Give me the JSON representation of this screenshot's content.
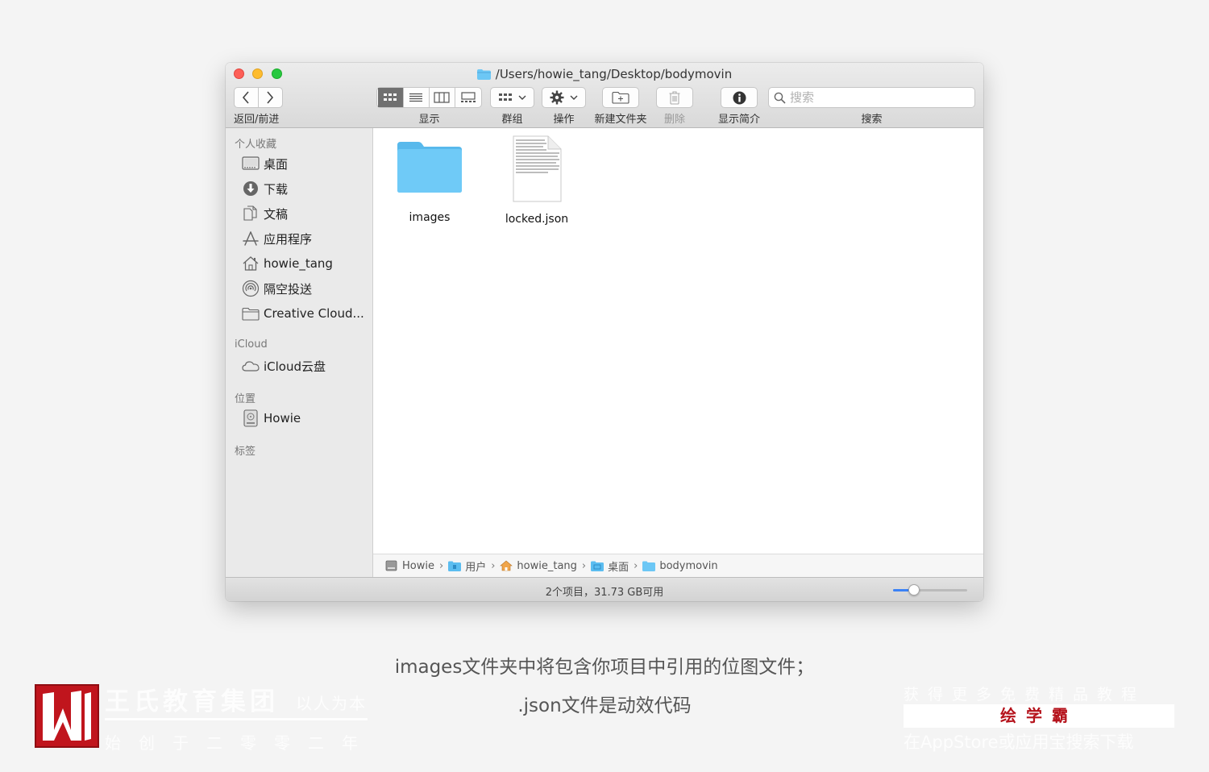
{
  "window": {
    "title": "/Users/howie_tang/Desktop/bodymovin"
  },
  "toolbar": {
    "nav_label": "返回/前进",
    "view_label": "显示",
    "group_label": "群组",
    "action_label": "操作",
    "new_folder_label": "新建文件夹",
    "delete_label": "删除",
    "info_label": "显示简介",
    "search_label": "搜索",
    "search_placeholder": "搜索"
  },
  "sidebar": {
    "favorites_header": "个人收藏",
    "favorites": [
      {
        "label": "桌面",
        "icon": "desktop-icon"
      },
      {
        "label": "下载",
        "icon": "download-icon"
      },
      {
        "label": "文稿",
        "icon": "documents-icon"
      },
      {
        "label": "应用程序",
        "icon": "applications-icon"
      },
      {
        "label": "howie_tang",
        "icon": "home-icon"
      },
      {
        "label": "隔空投送",
        "icon": "airdrop-icon"
      },
      {
        "label": "Creative Cloud...",
        "icon": "folder-icon"
      }
    ],
    "icloud_header": "iCloud",
    "icloud_items": [
      {
        "label": "iCloud云盘",
        "icon": "cloud-icon"
      }
    ],
    "locations_header": "位置",
    "locations": [
      {
        "label": "Howie",
        "icon": "hard-drive-icon"
      }
    ],
    "tags_header": "标签"
  },
  "files": [
    {
      "name": "images",
      "type": "folder"
    },
    {
      "name": "locked.json",
      "type": "file"
    }
  ],
  "pathbar": [
    {
      "label": "Howie",
      "icon": "hard-drive-icon"
    },
    {
      "label": "用户",
      "icon": "users-folder-icon"
    },
    {
      "label": "howie_tang",
      "icon": "home-icon"
    },
    {
      "label": "桌面",
      "icon": "desktop-folder-icon"
    },
    {
      "label": "bodymovin",
      "icon": "folder-icon"
    }
  ],
  "status": {
    "text": "2个项目，31.73 GB可用",
    "icon_size_slider": 0.28
  },
  "captions": {
    "line1": "images文件夹中将包含你项目中引用的位图文件；",
    "line2": ".json文件是动效代码"
  },
  "branding": {
    "main": "王氏教育集团",
    "slogan": "以人为本",
    "sub": "始创于二零零二年",
    "promo_top": "获得更多免费精品教程",
    "promo_box": "绘学霸",
    "promo_bottom": "在AppStore或应用宝搜索下载"
  },
  "colors": {
    "accent": "#3b82f6",
    "folder": "#6cc7f5",
    "brand_red": "#c0151d"
  }
}
